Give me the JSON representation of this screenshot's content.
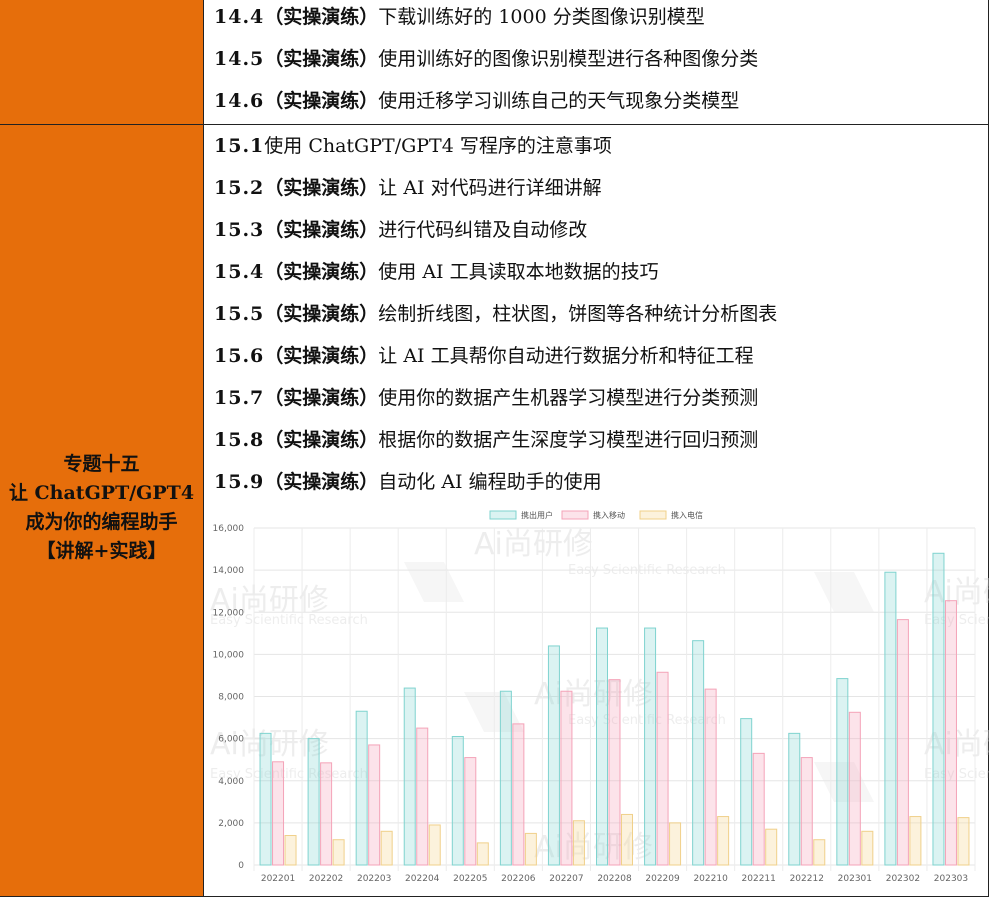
{
  "section14": {
    "rows": [
      {
        "num": "14.4",
        "tag": "（实操演练）",
        "text": "下载训练好的 1000 分类图像识别模型"
      },
      {
        "num": "14.5",
        "tag": "（实操演练）",
        "text": "使用训练好的图像识别模型进行各种图像分类"
      },
      {
        "num": "14.6",
        "tag": "（实操演练）",
        "text": "使用迁移学习训练自己的天气现象分类模型"
      }
    ]
  },
  "section15": {
    "topic_lines": [
      "专题十五",
      "让 ChatGPT/GPT4",
      "成为你的编程助手",
      "【讲解+实践】"
    ],
    "rows": [
      {
        "num": "15.1",
        "tag": "",
        "text": "使用 ChatGPT/GPT4 写程序的注意事项"
      },
      {
        "num": "15.2",
        "tag": "（实操演练）",
        "text": "让 AI 对代码进行详细讲解"
      },
      {
        "num": "15.3",
        "tag": "（实操演练）",
        "text": "进行代码纠错及自动修改"
      },
      {
        "num": "15.4",
        "tag": "（实操演练）",
        "text": "使用 AI 工具读取本地数据的技巧"
      },
      {
        "num": "15.5",
        "tag": "（实操演练）",
        "text": "绘制折线图，柱状图，饼图等各种统计分析图表"
      },
      {
        "num": "15.6",
        "tag": "（实操演练）",
        "text": "让 AI 工具帮你自动进行数据分析和特征工程"
      },
      {
        "num": "15.7",
        "tag": "（实操演练）",
        "text": "使用你的数据产生机器学习模型进行分类预测"
      },
      {
        "num": "15.8",
        "tag": "（实操演练）",
        "text": "根据你的数据产生深度学习模型进行回归预测"
      },
      {
        "num": "15.9",
        "tag": "（实操演练）",
        "text": "自动化 AI 编程助手的使用"
      }
    ]
  },
  "watermark": {
    "brand": "Ai尚研修",
    "subtitle": "Easy Scientific Research"
  },
  "colors": {
    "topic_bg": "#e66e0b",
    "series1": "#7fd3cf",
    "series2": "#f4a3b8",
    "series3": "#f7d99a"
  },
  "chart_data": {
    "type": "bar",
    "categories": [
      "202201",
      "202202",
      "202203",
      "202204",
      "202205",
      "202206",
      "202207",
      "202208",
      "202209",
      "202210",
      "202211",
      "202212",
      "202301",
      "202302",
      "202303"
    ],
    "series": [
      {
        "name": "携出用户",
        "values": [
          6250,
          6000,
          7300,
          8400,
          6100,
          8250,
          10400,
          11250,
          11250,
          10650,
          6950,
          6250,
          8850,
          13900,
          14800
        ]
      },
      {
        "name": "携入移动",
        "values": [
          4900,
          4850,
          5700,
          6500,
          5100,
          6700,
          8250,
          8800,
          9150,
          8350,
          5300,
          5100,
          7250,
          11650,
          12550
        ]
      },
      {
        "name": "携入电信",
        "values": [
          1400,
          1200,
          1600,
          1900,
          1050,
          1500,
          2100,
          2400,
          2000,
          2300,
          1700,
          1200,
          1600,
          2300,
          2250
        ]
      }
    ],
    "yticks": [
      "0",
      "2,000",
      "4,000",
      "6,000",
      "8,000",
      "10,000",
      "12,000",
      "14,000",
      "16,000"
    ],
    "ylim": [
      0,
      16000
    ],
    "legend_position": "top-center",
    "grid": true
  }
}
